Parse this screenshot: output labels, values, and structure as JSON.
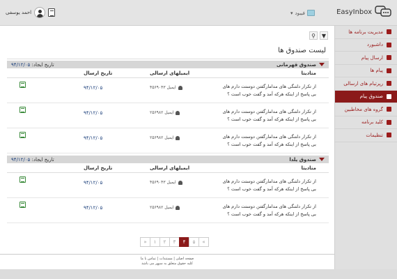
{
  "header": {
    "app_name": "EasyInbox",
    "language": "فیبود",
    "user_name": "احمد یوسفی"
  },
  "sidebar": {
    "items": [
      {
        "label": "مدیریت برنامه ها",
        "icon": "grid-icon",
        "active": false
      },
      {
        "label": "داشبورد",
        "icon": "dashboard-icon",
        "active": false
      },
      {
        "label": "ارسال پیام",
        "icon": "send-icon",
        "active": false
      },
      {
        "label": "پیام ها",
        "icon": "message-icon",
        "active": false
      },
      {
        "label": "رپرتیام های ارسالی",
        "icon": "list-icon",
        "active": false
      },
      {
        "label": "صندوق پیام",
        "icon": "envelope-icon",
        "active": true
      },
      {
        "label": "گروه های مخاطبین",
        "icon": "users-icon",
        "active": false
      },
      {
        "label": "کلید برنامه",
        "icon": "key-icon",
        "active": false
      },
      {
        "label": "تنظیمات",
        "icon": "settings-icon",
        "active": false
      }
    ]
  },
  "main": {
    "title": "لیست صندوق ها",
    "columns": {
      "content": "متادیتا",
      "emails": "ایمیلهای ارسالی",
      "date": "تاریخ ارسال"
    },
    "created_label": "تاریخ ایجاد:",
    "groups": [
      {
        "name": "صندوق قهرمانی",
        "created": "۹۴/۱۲/۰۵",
        "rows": [
          {
            "line1": "از تکرار دلتنگی های مدامارگفتن دوستت دارم های",
            "line2": "بی پاسخ از اینکه هرکه آمد و گفت خوب است ؟",
            "emails": "۴۵۶۹۰۴۳ ایمیل",
            "date": "۹۴/۱۲/۰۵"
          },
          {
            "line1": "از تکرار دلتنگی های مدامارگفتن دوستت دارم های",
            "line2": "بی پاسخ از اینکه هرکه آمد و گفت خوب است ؟",
            "emails": "۲۵۶۹۸۲ ایمیل",
            "date": "۹۴/۱۲/۰۵"
          },
          {
            "line1": "از تکرار دلتنگی های مدامارگفتن دوستت دارم های",
            "line2": "بی پاسخ از اینکه هرکه آمد و گفت خوب است ؟",
            "emails": "۲۵۶۹۸۲ ایمیل",
            "date": "۹۴/۱۲/۰۵"
          }
        ]
      },
      {
        "name": "صندوق یلدا",
        "created": "۹۴/۱۲/۰۵",
        "rows": [
          {
            "line1": "از تکرار دلتنگی های مدامارگفتن دوستت دارم های",
            "line2": "بی پاسخ از اینکه هرکه آمد و گفت خوب است ؟",
            "emails": "۴۵۶۹۰۴۳ ایمیل",
            "date": "۹۴/۱۲/۰۵"
          },
          {
            "line1": "از تکرار دلتنگی های مدامارگفتن دوستت دارم های",
            "line2": "بی پاسخ از اینکه هرکه آمد و گفت خوب است ؟",
            "emails": "۲۵۶۹۸۲ ایمیل",
            "date": "۹۴/۱۲/۰۵"
          }
        ]
      }
    ]
  },
  "pagination": {
    "pages": [
      "»",
      "۱",
      "۲",
      "۳",
      "۴",
      "۵",
      "«"
    ],
    "active": "۴"
  },
  "footer": {
    "line1": "صفحه اصلی | مستندات | تماس با ما",
    "line2": "کلیه حقوق متعلق به سپهر می باشد"
  }
}
